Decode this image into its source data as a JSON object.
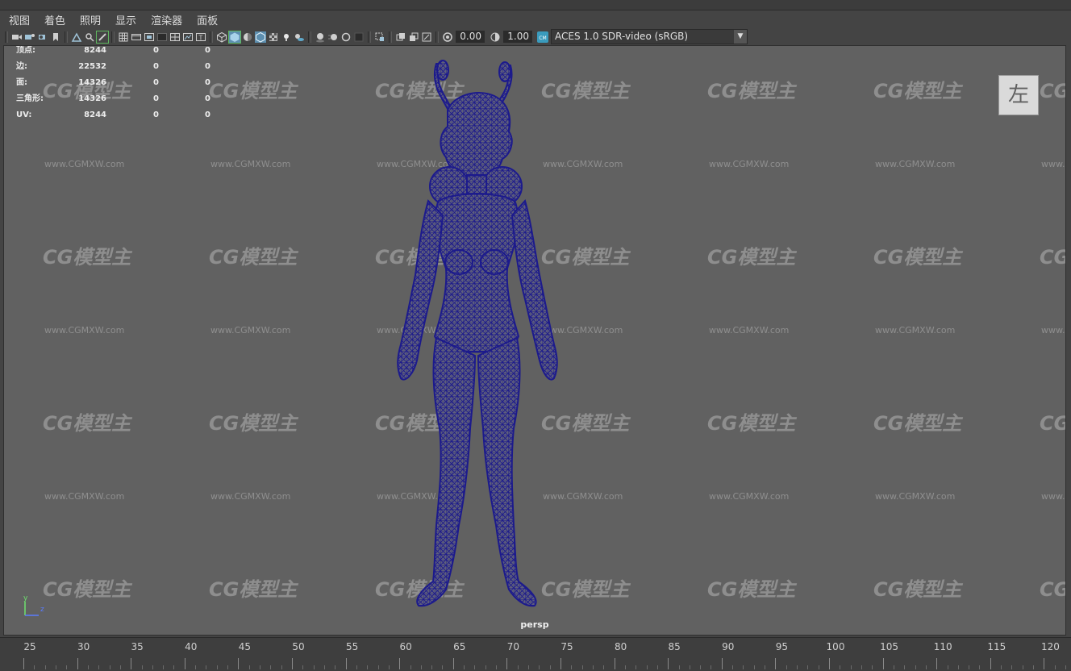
{
  "menu": [
    "视图",
    "着色",
    "照明",
    "显示",
    "渲染器",
    "面板"
  ],
  "toolbar": {
    "icons": [
      "select-camera-icon",
      "camera-attributes-icon",
      "bookmark-icon",
      "image-plane-icon",
      "two-d-pan-zoom-icon",
      "grease-pencil-icon",
      "grid-icon",
      "film-gate-icon",
      "resolution-gate-icon",
      "gate-mask-icon",
      "field-chart-icon",
      "safe-action-icon",
      "safe-title-icon",
      "wireframe-icon",
      "smooth-shade-icon",
      "default-material-icon",
      "xray-icon",
      "wireframe-on-shaded-icon",
      "texture-icon",
      "all-lights-icon",
      "shadows-icon",
      "screen-space-ao-icon",
      "motion-blur-icon",
      "multisample-aa-icon",
      "depth-of-field-icon",
      "isolate-select-icon",
      "xray-joints-icon",
      "xray-active-icon",
      "camera-frame-icon",
      "exposure-icon",
      "gamma-icon",
      "color-management-icon"
    ],
    "exposure": "0.00",
    "gamma": "1.00",
    "color_space": "ACES 1.0 SDR-video (sRGB)"
  },
  "hud": {
    "rows": [
      {
        "label": "顶点:",
        "v1": "8244",
        "v2": "0",
        "v3": "0"
      },
      {
        "label": "边:",
        "v1": "22532",
        "v2": "0",
        "v3": "0"
      },
      {
        "label": "面:",
        "v1": "14326",
        "v2": "0",
        "v3": "0"
      },
      {
        "label": "三角形:",
        "v1": "14326",
        "v2": "0",
        "v3": "0"
      },
      {
        "label": "UV:",
        "v1": "8244",
        "v2": "0",
        "v3": "0"
      }
    ]
  },
  "viewcube_label": "左",
  "camera_label": "persp",
  "axis": {
    "y": "y",
    "z": "z"
  },
  "watermark": {
    "logo": "CG模型主",
    "url": "www.CGMXW.com"
  },
  "mesh_color": "#1c1a8c",
  "timeline": {
    "ticks": [
      "25",
      "30",
      "35",
      "40",
      "45",
      "50",
      "55",
      "60",
      "65",
      "70",
      "75",
      "80",
      "85",
      "90",
      "95",
      "100",
      "105",
      "110",
      "115",
      "120"
    ]
  }
}
